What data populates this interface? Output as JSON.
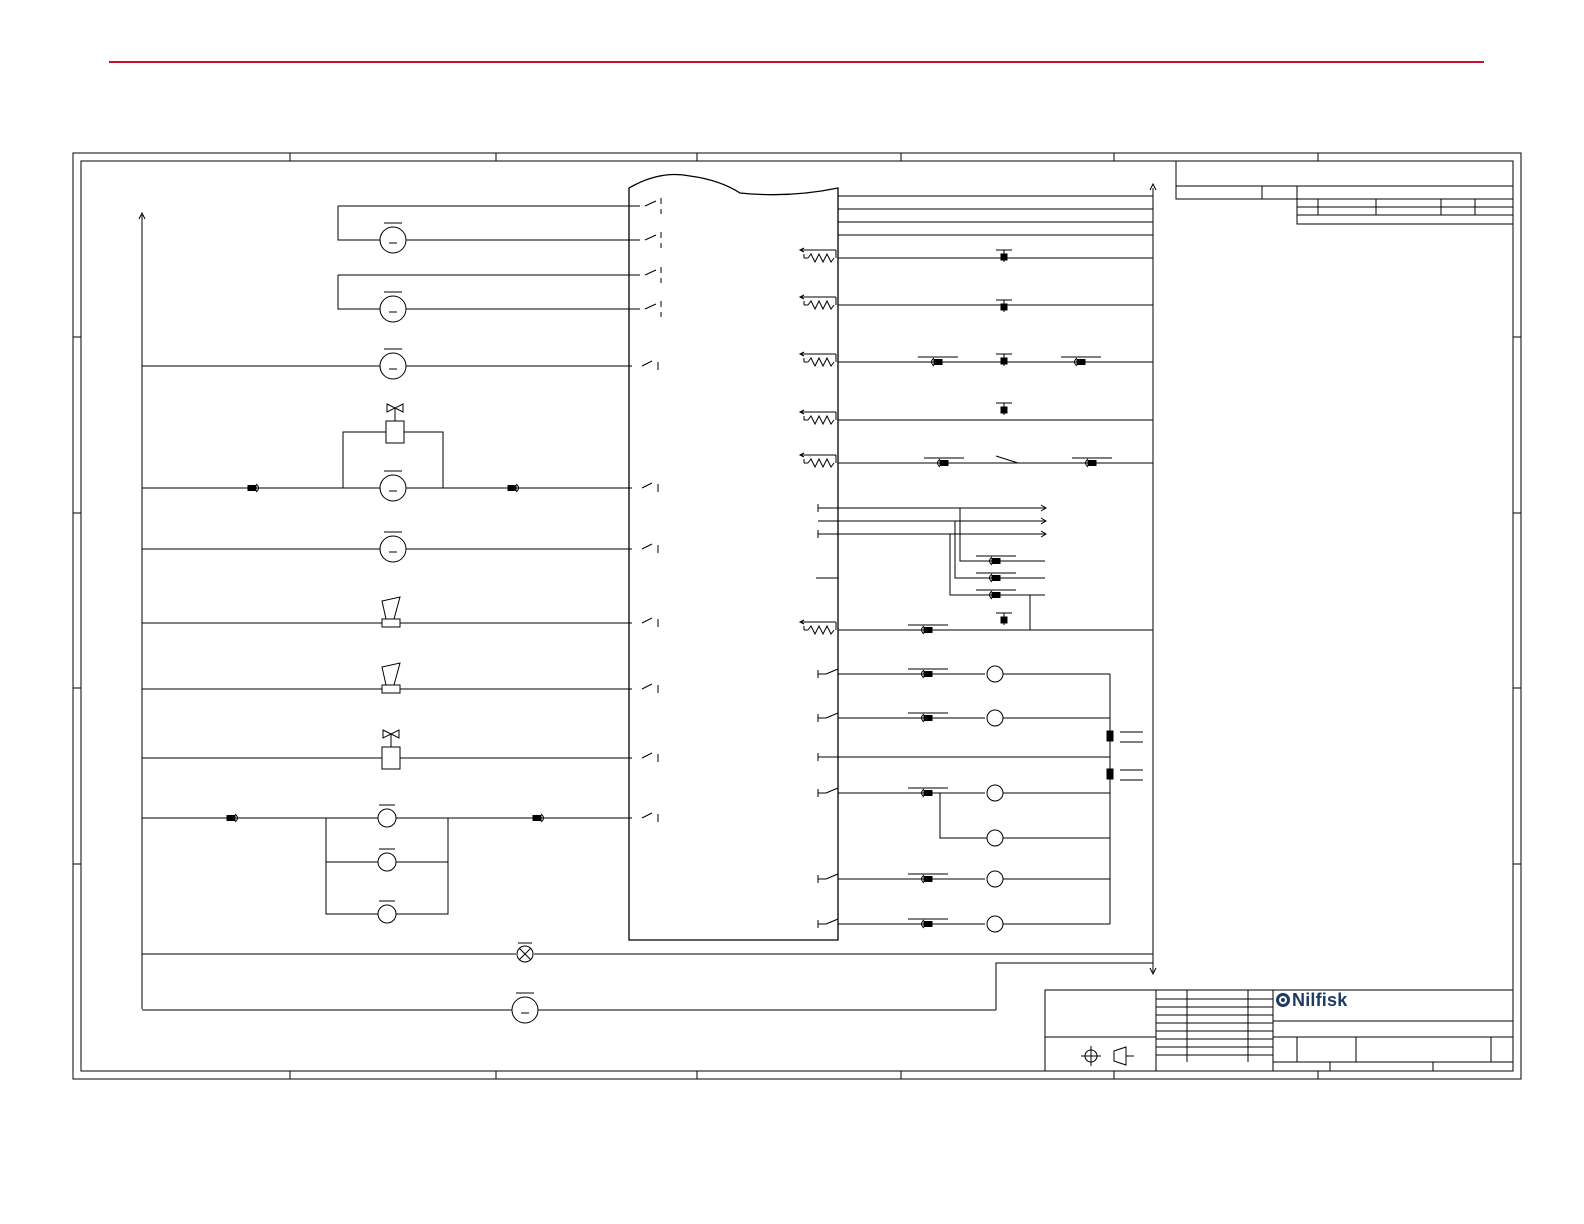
{
  "header": {
    "rule_color": "#c8102e"
  },
  "title_block": {
    "brand": "Nilfisk",
    "brand_color": "#1f3a63"
  },
  "colors": {
    "line": "#000000",
    "paper": "#ffffff"
  }
}
